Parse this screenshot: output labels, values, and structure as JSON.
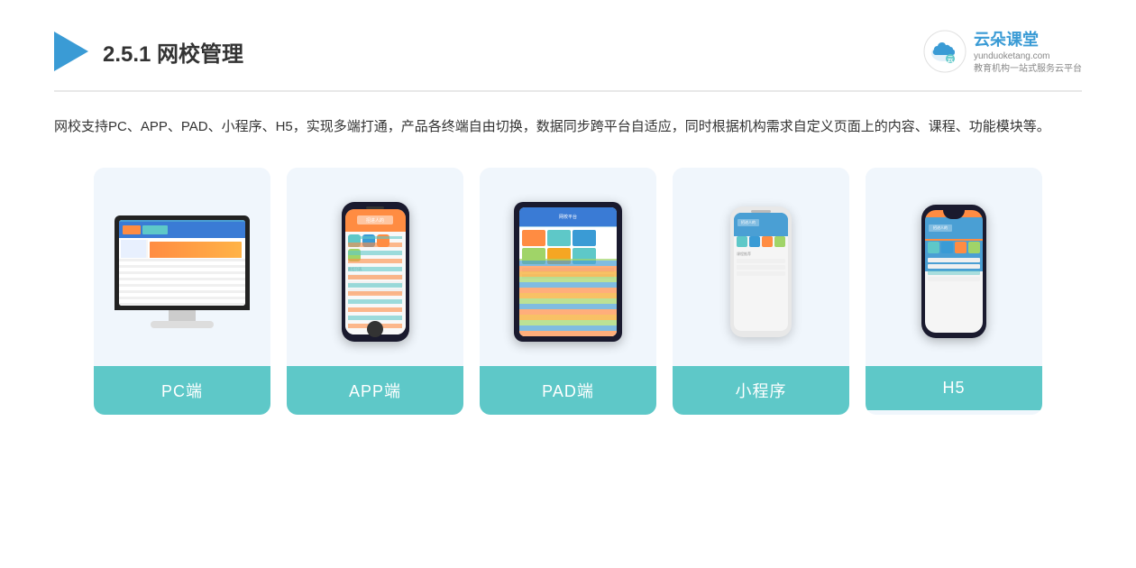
{
  "header": {
    "title_prefix": "2.5.1 ",
    "title_bold": "网校管理",
    "brand_name": "云朵课堂",
    "brand_url": "yunduoketang.com",
    "brand_tagline_line1": "教育机构一站",
    "brand_tagline_line2": "式服务云平台"
  },
  "description": {
    "text": "网校支持PC、APP、PAD、小程序、H5，实现多端打通，产品各终端自由切换，数据同步跨平台自适应，同时根据机构需求自定义页面上的内容、课程、功能模块等。"
  },
  "cards": [
    {
      "id": "pc",
      "label": "PC端",
      "device": "pc"
    },
    {
      "id": "app",
      "label": "APP端",
      "device": "phone"
    },
    {
      "id": "pad",
      "label": "PAD端",
      "device": "tablet"
    },
    {
      "id": "miniprogram",
      "label": "小程序",
      "device": "phone-mini"
    },
    {
      "id": "h5",
      "label": "H5",
      "device": "phone-notch"
    }
  ],
  "colors": {
    "card_bg": "#edf4fc",
    "card_label_bg": "#5ec8c8",
    "title_color": "#333333",
    "brand_color": "#3a9bd5"
  }
}
